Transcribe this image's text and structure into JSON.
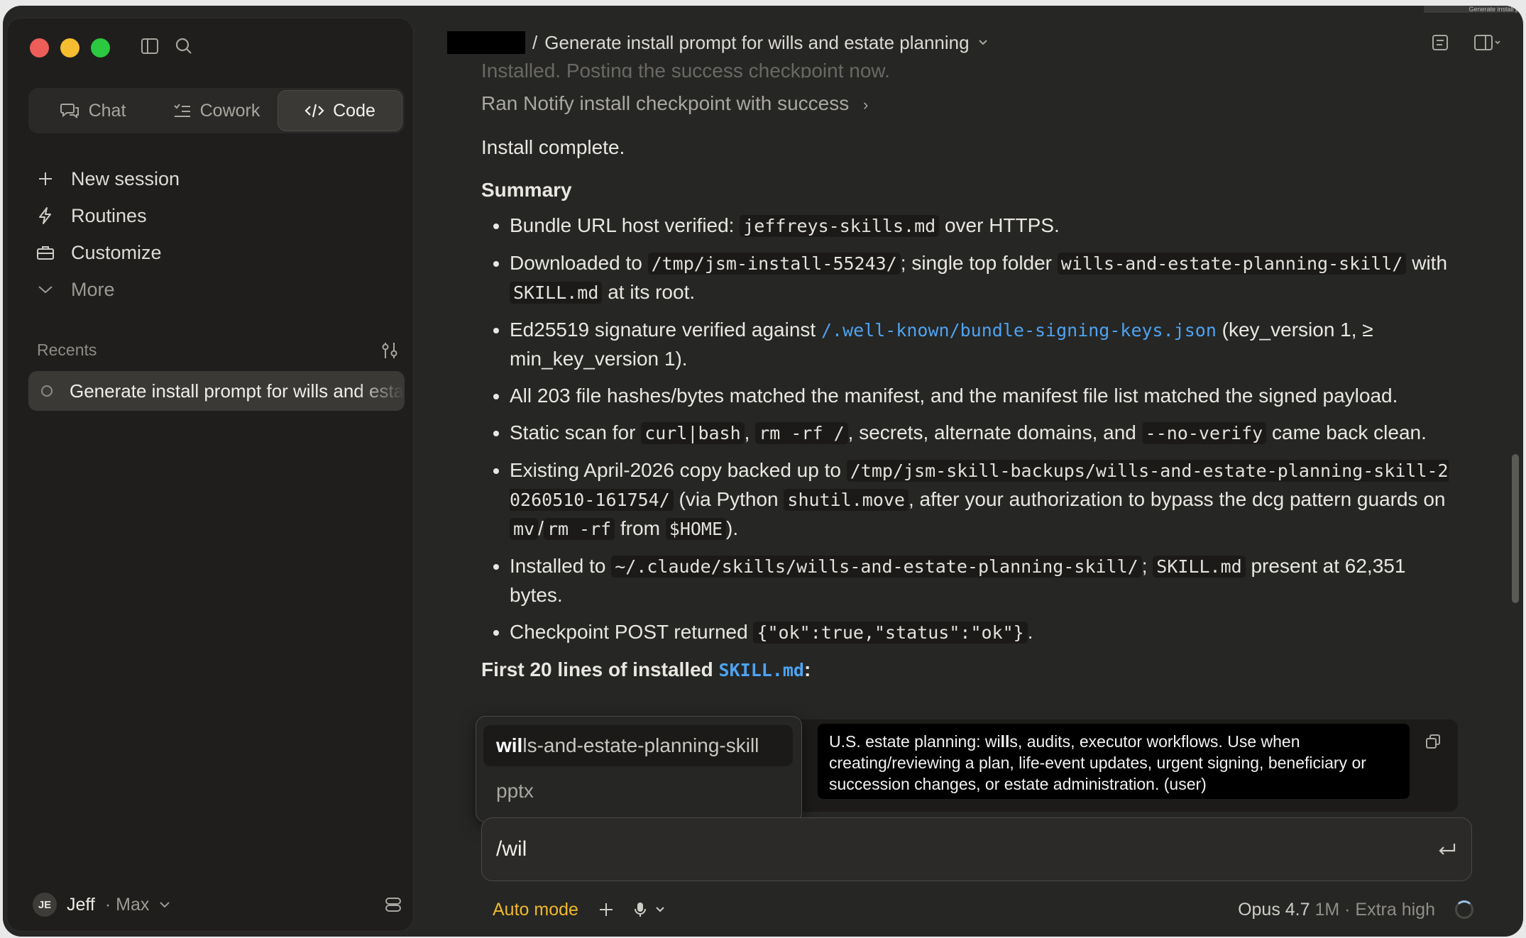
{
  "thumbnail_label": "Generate install p",
  "sidebar": {
    "tabs": [
      {
        "label": "Chat",
        "icon": "chat-bubbles-icon",
        "active": false
      },
      {
        "label": "Cowork",
        "icon": "checklist-icon",
        "active": false
      },
      {
        "label": "Code",
        "icon": "code-brackets-icon",
        "active": true
      }
    ],
    "nav": [
      {
        "label": "New session",
        "icon": "plus-icon"
      },
      {
        "label": "Routines",
        "icon": "bolt-icon"
      },
      {
        "label": "Customize",
        "icon": "briefcase-icon"
      },
      {
        "label": "More",
        "icon": "chevron-down-icon"
      }
    ],
    "recents_label": "Recents",
    "recents": [
      {
        "label": "Generate install prompt for wills and estate planning"
      }
    ],
    "user": {
      "initials": "JE",
      "name": "Jeff",
      "plan": "· Max"
    }
  },
  "header": {
    "breadcrumb_sep": "/",
    "title": "Generate install prompt for wills and estate planning"
  },
  "content": {
    "faded_line": "Installed. Posting the success checkpoint now.",
    "ran_line": "Ran Notify install checkpoint with success",
    "complete": "Install complete.",
    "summary_heading": "Summary",
    "b1": {
      "t1": "Bundle URL host verified: ",
      "c1": "jeffreys-skills.md",
      "t2": " over HTTPS."
    },
    "b2": {
      "t1": "Downloaded to ",
      "c1": "/tmp/jsm-install-55243/",
      "t2": "; single top folder ",
      "c2": "wills-and-estate-planning-skill/",
      "t3": " with ",
      "c3": "SKILL.md",
      "t4": " at its root."
    },
    "b3": {
      "t1": "Ed25519 signature verified against ",
      "c1": "/.well-known/bundle-signing-keys.json",
      "t2": " (key_version 1, ≥ min_key_version 1)."
    },
    "b4": {
      "t1": "All 203 file hashes/bytes matched the manifest, and the manifest file list matched the signed payload."
    },
    "b5": {
      "t1": "Static scan for ",
      "c1": "curl|bash",
      "t2": ", ",
      "c2": "rm -rf /",
      "t3": ", secrets, alternate domains, and ",
      "c3": "--no-verify",
      "t4": " came back clean."
    },
    "b6": {
      "t1": "Existing April-2026 copy backed up to ",
      "c1": "/tmp/jsm-skill-backups/wills-and-estate-planning-skill-20260510-161754/",
      "t2": " (via Python ",
      "c2": "shutil.move",
      "t3": ", after your authorization to bypass the dcg pattern guards on ",
      "c3": "mv",
      "t4": "/",
      "c4": "rm -rf",
      "t5": " from ",
      "c5": "$HOME",
      "t6": ")."
    },
    "b7": {
      "t1": "Installed to ",
      "c1": "~/.claude/skills/wills-and-estate-planning-skill/",
      "t2": "; ",
      "c2": "SKILL.md",
      "t3": " present at 62,351 bytes."
    },
    "b8": {
      "t1": "Checkpoint POST returned ",
      "c1": "{\"ok\":true,\"status\":\"ok\"}",
      "t2": "."
    },
    "first_lines": {
      "t1": "First 20 lines of installed ",
      "c1": "SKILL.md",
      "t2": ":"
    }
  },
  "autocomplete": {
    "options": [
      {
        "match": "wil",
        "rest": "ls-and-estate-planning-skill",
        "selected": true
      },
      {
        "label": "pptx",
        "selected": false
      }
    ],
    "tooltip": {
      "bold": "U.S. estate planning: wi",
      "bold2": "ll",
      "text": "s, audits, executor workflows. Use when creating/reviewing a plan, life-event updates, urgent signing, beneficiary or succession changes, or estate administration. (user)"
    }
  },
  "input": {
    "value": "/wil"
  },
  "footer": {
    "mode": "Auto mode",
    "model": "Opus 4.7",
    "context": "1M",
    "effort": "· Extra high"
  },
  "colors": {
    "background": "#262624",
    "sidebar": "#1f1e1d",
    "accent_link": "#4ea3f1",
    "auto_mode": "#f0b92d",
    "traffic_red": "#ed5e58",
    "traffic_yellow": "#f5bd2f",
    "traffic_green": "#2ac940"
  }
}
